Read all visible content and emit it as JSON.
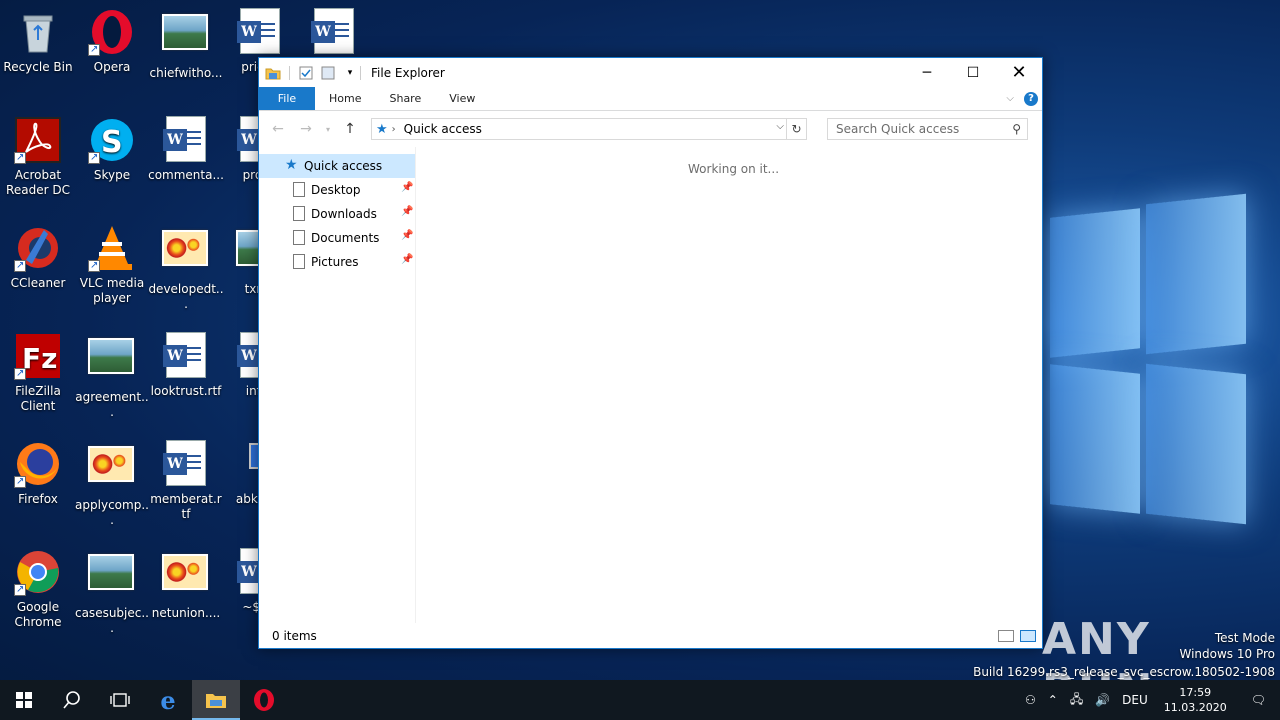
{
  "desktop": {
    "icons": [
      {
        "label": "Recycle Bin",
        "type": "recycle-bin-icon"
      },
      {
        "label": "Opera",
        "type": "opera-icon"
      },
      {
        "label": "chiefwitho...",
        "type": "image-file-icon"
      },
      {
        "label": "priceh",
        "type": "word-doc-icon"
      },
      {
        "label": "",
        "type": "word-doc-icon"
      },
      {
        "label": "Acrobat Reader DC",
        "type": "acrobat-icon"
      },
      {
        "label": "Skype",
        "type": "skype-icon"
      },
      {
        "label": "commenta...",
        "type": "word-doc-icon"
      },
      {
        "label": "produ",
        "type": "word-doc-icon"
      },
      {
        "label": "CCleaner",
        "type": "ccleaner-icon"
      },
      {
        "label": "VLC media player",
        "type": "vlc-icon"
      },
      {
        "label": "developedt...",
        "type": "flower-image-icon"
      },
      {
        "label": "txma",
        "type": "image-file-icon"
      },
      {
        "label": "FileZilla Client",
        "type": "filezilla-icon"
      },
      {
        "label": "agreement...",
        "type": "image-file-icon"
      },
      {
        "label": "looktrust.rtf",
        "type": "word-doc-icon"
      },
      {
        "label": "info_",
        "type": "word-doc-icon"
      },
      {
        "label": "Firefox",
        "type": "firefox-icon"
      },
      {
        "label": "applycomp...",
        "type": "flower-image-icon"
      },
      {
        "label": "memberat.rtf",
        "type": "word-doc-icon"
      },
      {
        "label": "abk Sho",
        "type": "monitor-icon"
      },
      {
        "label": "Google Chrome",
        "type": "chrome-icon"
      },
      {
        "label": "casesubjec...",
        "type": "image-file-icon"
      },
      {
        "label": "netunion....",
        "type": "flower-image-icon"
      },
      {
        "label": "~$fo_",
        "type": "word-doc-icon"
      }
    ]
  },
  "explorer": {
    "title": "File Explorer",
    "ribbon_tabs": [
      "File",
      "Home",
      "Share",
      "View"
    ],
    "help_label": "?",
    "address": "Quick access",
    "search_placeholder": "Search Quick access",
    "nav": {
      "root": "Quick access",
      "items": [
        "Desktop",
        "Downloads",
        "Documents",
        "Pictures"
      ]
    },
    "status_message": "Working on it...",
    "item_count": "0 items"
  },
  "watermark": {
    "line1": "Test Mode",
    "line2": "Windows 10 Pro",
    "line3": "Build 16299.rs3_release_svc_escrow.180502-1908",
    "brand": "ANY RUN"
  },
  "taskbar": {
    "language": "DEU",
    "time": "17:59",
    "date": "11.03.2020"
  },
  "colors": {
    "accent": "#1979ca",
    "selection": "#cce8ff",
    "taskbar": "#101820"
  }
}
